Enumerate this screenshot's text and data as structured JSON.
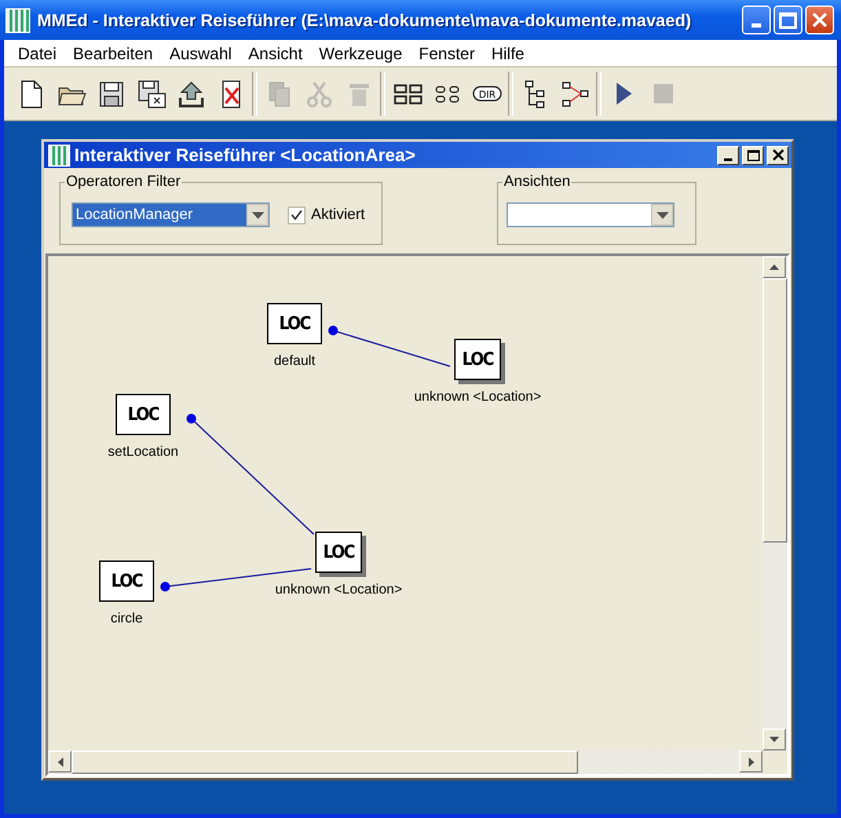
{
  "window": {
    "title": "MMEd - Interaktiver Reiseführer (E:\\mava-dokumente\\mava-dokumente.mavaed)"
  },
  "menu": [
    "Datei",
    "Bearbeiten",
    "Auswahl",
    "Ansicht",
    "Werkzeuge",
    "Fenster",
    "Hilfe"
  ],
  "toolbar": [
    {
      "kind": "new",
      "disabled": false
    },
    {
      "kind": "open",
      "disabled": false
    },
    {
      "kind": "save",
      "disabled": false
    },
    {
      "kind": "saveas",
      "disabled": false
    },
    {
      "kind": "export",
      "disabled": false
    },
    {
      "kind": "close",
      "disabled": false
    },
    {
      "kind": "sep"
    },
    {
      "kind": "copy",
      "disabled": true
    },
    {
      "kind": "cut",
      "disabled": true
    },
    {
      "kind": "delete",
      "disabled": true
    },
    {
      "kind": "sep"
    },
    {
      "kind": "grid",
      "disabled": false
    },
    {
      "kind": "dots",
      "disabled": false
    },
    {
      "kind": "dir",
      "disabled": false,
      "text": "DIR"
    },
    {
      "kind": "sep"
    },
    {
      "kind": "tree",
      "disabled": false
    },
    {
      "kind": "graph",
      "disabled": false
    },
    {
      "kind": "sep"
    },
    {
      "kind": "play",
      "disabled": false
    },
    {
      "kind": "stop",
      "disabled": true
    }
  ],
  "inner_window": {
    "title": "Interaktiver Reiseführer <LocationArea>",
    "filter": {
      "legend": "Operatoren Filter",
      "value": "LocationManager",
      "checkbox": {
        "label": "Aktiviert",
        "checked": true
      }
    },
    "views": {
      "legend": "Ansichten"
    },
    "nodes": [
      {
        "icon": "LOC",
        "label": "default",
        "kind": "source"
      },
      {
        "icon": "LOC",
        "label": "unknown <Location>",
        "kind": "target"
      },
      {
        "icon": "LOC",
        "label": "setLocation",
        "kind": "source"
      },
      {
        "icon": "LOC",
        "label": "unknown <Location>",
        "kind": "target"
      },
      {
        "icon": "LOC",
        "label": "circle",
        "kind": "source"
      }
    ]
  }
}
